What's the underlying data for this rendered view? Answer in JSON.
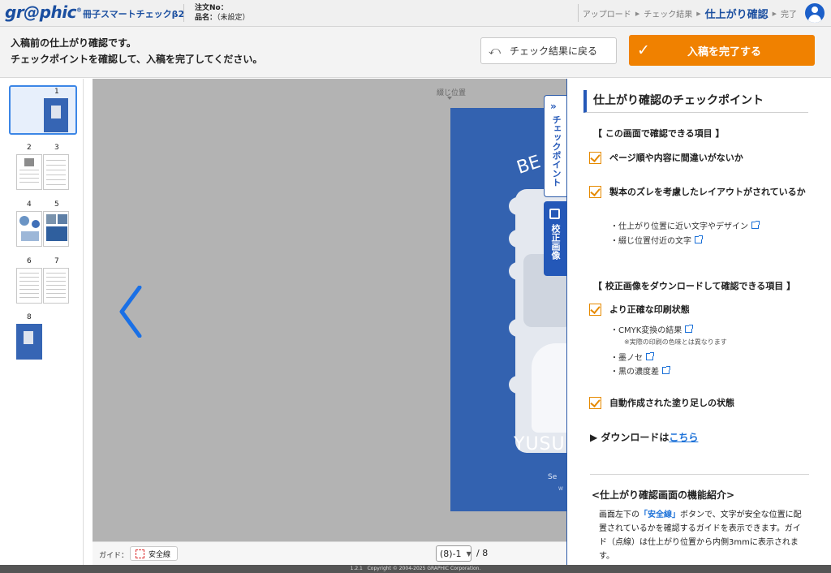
{
  "header": {
    "logo": "gr@phic",
    "logo_mark": "®",
    "app_name": "冊子スマートチェックβ2",
    "order_no_label": "注文No：",
    "product_label": "品名：",
    "product_value": "（未設定）",
    "steps": [
      "アップロード",
      "チェック結果",
      "仕上がり確認",
      "完了"
    ],
    "current_step": "仕上がり確認"
  },
  "instruction": {
    "line1": "入稿前の仕上がり確認です。",
    "line2": "チェックポイントを確認して、入稿を完了してください。",
    "back_button": "チェック結果に戻る",
    "complete_button": "入稿を完了する",
    "accent_color": "#f08100"
  },
  "thumbnails": [
    {
      "label": "1"
    },
    {
      "label": "2"
    },
    {
      "label": "3"
    },
    {
      "label": "4"
    },
    {
      "label": "5"
    },
    {
      "label": "6"
    },
    {
      "label": "7"
    },
    {
      "label": "8"
    }
  ],
  "canvas": {
    "spine_label": "綴じ位置",
    "cover_text_top": "BE",
    "cover_text_bottom": "YUSUKI",
    "cover_small1": "Se",
    "cover_small2": "W"
  },
  "bottom_bar": {
    "guide_label": "ガイド：",
    "safe_line_button": "安全線",
    "page_select_value": "(8)-1",
    "page_total": "/ 8"
  },
  "side_tabs": {
    "checkpoint": "チェックポイント",
    "proof_image": "校正画像"
  },
  "panel": {
    "title": "仕上がり確認のチェックポイント",
    "section1": "【 この画面で確認できる項目 】",
    "item1": "ページ順や内容に間違いがないか",
    "item2": "製本のズレを考慮したレイアウトがされているか",
    "item2_sub1": "・仕上がり位置に近い文字やデザイン",
    "item2_sub2": "・綴じ位置付近の文字",
    "section2": "【 校正画像をダウンロードして確認できる項目 】",
    "item3": "より正確な印刷状態",
    "item3_sub1": "・CMYK変換の結果",
    "item3_note": "※実際の印刷の色味とは異なります",
    "item3_sub2": "・墨ノセ",
    "item3_sub3": "・黒の濃度差",
    "item4": "自動作成された塗り足しの状態",
    "download_text": "▶ ダウンロードは",
    "download_link": "こちら",
    "feature_title": "<仕上がり確認画面の機能紹介>",
    "feature_text_pre": "画面左下の",
    "feature_text_hl": "「安全線」",
    "feature_text_post": "ボタンで、文字が安全な位置に配置されているかを確認するガイドを表示できます。ガイド（点線）は仕上がり位置から内側3mmに表示されます。"
  },
  "footer": {
    "version": "1.2.1",
    "copyright": "Copyright © 2004-2025 GRAPHIC Corporation."
  }
}
